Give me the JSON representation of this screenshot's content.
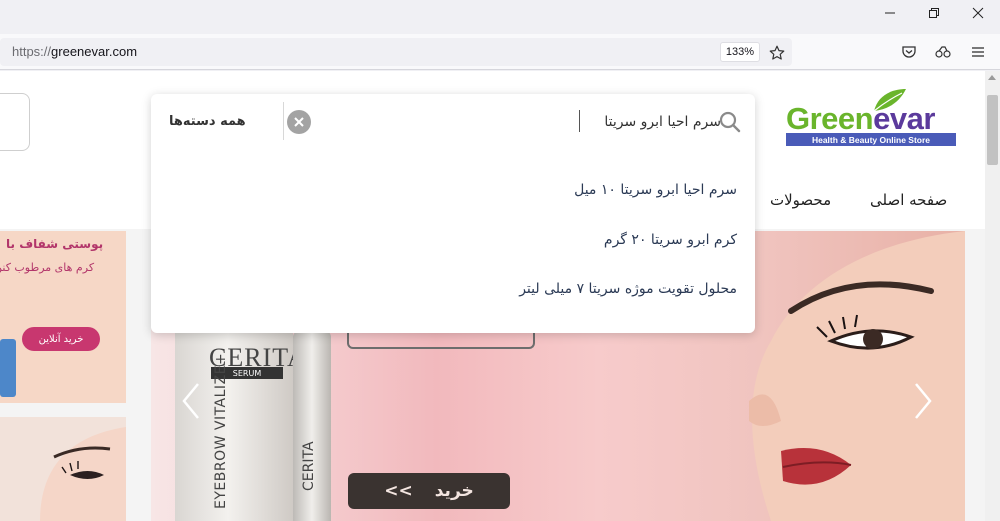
{
  "browser": {
    "url_protocol": "https://",
    "url_host": "greenevar.com",
    "zoom": "133%"
  },
  "site": {
    "logo_green": "Green",
    "logo_purple": "evar",
    "logo_tagline": "Health & Beauty Online Store",
    "nav": {
      "home": "صفحه اصلی",
      "products": "محصولات"
    }
  },
  "search": {
    "query": "سرم احیا ابرو سریتا",
    "category": "همه دسته‌ها",
    "suggestions": [
      "سرم احیا ابرو سریتا ۱۰ میل",
      "کرم ابرو سریتا ۲۰ گرم",
      "محلول تقویت موژه سریتا ۷ میلی لیتر"
    ]
  },
  "promo": {
    "title": "پوستی شفاف با",
    "subtitle": "کرم های مرطوب کنن",
    "shop_button": "خرید آنلاین"
  },
  "slider": {
    "product_brand": "CERITA",
    "product_type": "SERUM",
    "product_line": "EYEBROW VITALIZE+",
    "tube_brand": "CERITA",
    "buy_label": "خرید",
    "buy_arrows": "<<"
  }
}
